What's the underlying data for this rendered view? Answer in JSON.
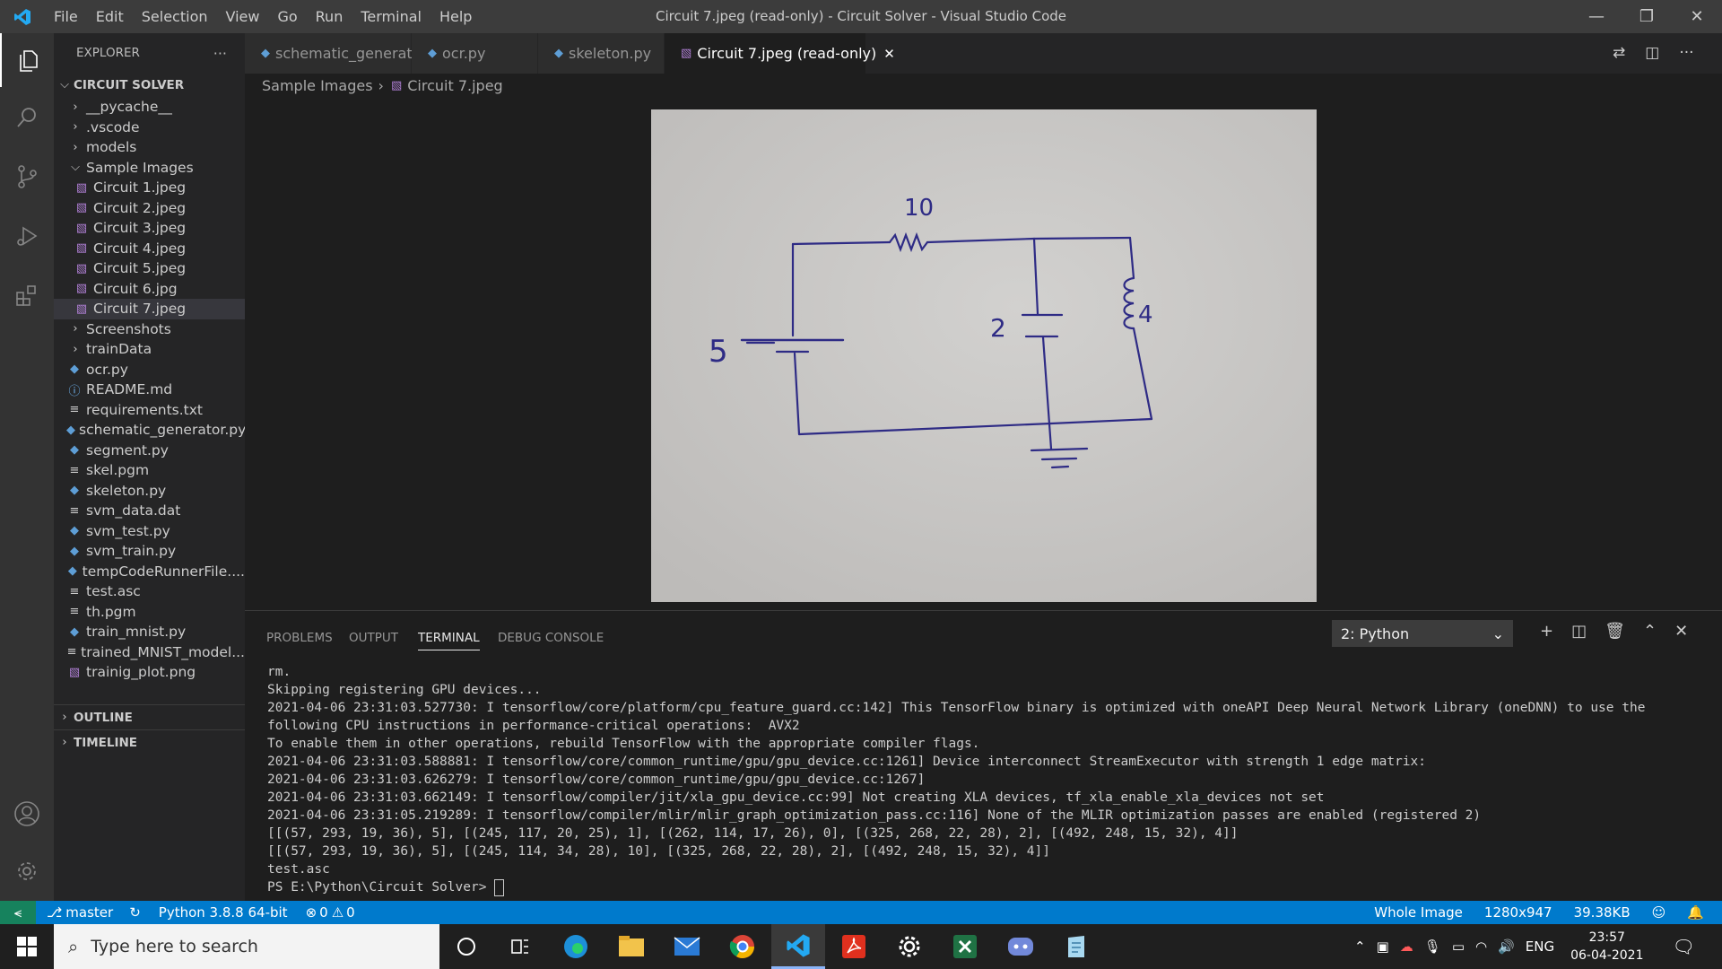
{
  "titlebar": {
    "menus": [
      "File",
      "Edit",
      "Selection",
      "View",
      "Go",
      "Run",
      "Terminal",
      "Help"
    ],
    "title": "Circuit 7.jpeg (read-only) - Circuit Solver - Visual Studio Code"
  },
  "sidebar": {
    "header": "EXPLORER",
    "project": "CIRCUIT SOLVER",
    "items": [
      {
        "label": "__pycache__",
        "kind": "folder"
      },
      {
        "label": ".vscode",
        "kind": "folder"
      },
      {
        "label": "models",
        "kind": "folder"
      },
      {
        "label": "Sample Images",
        "kind": "folder-open"
      },
      {
        "label": "Circuit 1.jpeg",
        "kind": "image"
      },
      {
        "label": "Circuit 2.jpeg",
        "kind": "image"
      },
      {
        "label": "Circuit 3.jpeg",
        "kind": "image"
      },
      {
        "label": "Circuit 4.jpeg",
        "kind": "image"
      },
      {
        "label": "Circuit 5.jpeg",
        "kind": "image"
      },
      {
        "label": "Circuit 6.jpg",
        "kind": "image"
      },
      {
        "label": "Circuit 7.jpeg",
        "kind": "image",
        "selected": true
      },
      {
        "label": "Screenshots",
        "kind": "folder"
      },
      {
        "label": "trainData",
        "kind": "folder"
      },
      {
        "label": "ocr.py",
        "kind": "python"
      },
      {
        "label": "README.md",
        "kind": "info"
      },
      {
        "label": "requirements.txt",
        "kind": "text"
      },
      {
        "label": "schematic_generator.py",
        "kind": "python"
      },
      {
        "label": "segment.py",
        "kind": "python"
      },
      {
        "label": "skel.pgm",
        "kind": "text"
      },
      {
        "label": "skeleton.py",
        "kind": "python"
      },
      {
        "label": "svm_data.dat",
        "kind": "text"
      },
      {
        "label": "svm_test.py",
        "kind": "python"
      },
      {
        "label": "svm_train.py",
        "kind": "python"
      },
      {
        "label": "tempCodeRunnerFile....",
        "kind": "python"
      },
      {
        "label": "test.asc",
        "kind": "text"
      },
      {
        "label": "th.pgm",
        "kind": "text"
      },
      {
        "label": "train_mnist.py",
        "kind": "python"
      },
      {
        "label": "trained_MNIST_model...",
        "kind": "text"
      },
      {
        "label": "trainig_plot.png",
        "kind": "image"
      }
    ],
    "outline": "OUTLINE",
    "timeline": "TIMELINE"
  },
  "tabs": [
    {
      "label": "schematic_generator.py",
      "kind": "python"
    },
    {
      "label": "ocr.py",
      "kind": "python"
    },
    {
      "label": "skeleton.py",
      "kind": "python"
    },
    {
      "label": "Circuit 7.jpeg (read-only)",
      "kind": "image",
      "active": true
    }
  ],
  "breadcrumb": {
    "folder": "Sample Images",
    "file": "Circuit 7.jpeg"
  },
  "circuit": {
    "resistor": "10",
    "source": "5",
    "capacitor": "2",
    "inductor": "4"
  },
  "panel": {
    "tabs": [
      "PROBLEMS",
      "OUTPUT",
      "TERMINAL",
      "DEBUG CONSOLE"
    ],
    "active_tab": "TERMINAL",
    "terminal_select": "2: Python",
    "lines": [
      "rm.",
      "Skipping registering GPU devices...",
      "2021-04-06 23:31:03.527730: I tensorflow/core/platform/cpu_feature_guard.cc:142] This TensorFlow binary is optimized with oneAPI Deep Neural Network Library (oneDNN) to use the",
      "following CPU instructions in performance-critical operations:  AVX2",
      "To enable them in other operations, rebuild TensorFlow with the appropriate compiler flags.",
      "2021-04-06 23:31:03.588881: I tensorflow/core/common_runtime/gpu/gpu_device.cc:1261] Device interconnect StreamExecutor with strength 1 edge matrix:",
      "2021-04-06 23:31:03.626279: I tensorflow/core/common_runtime/gpu/gpu_device.cc:1267]",
      "2021-04-06 23:31:03.662149: I tensorflow/compiler/jit/xla_gpu_device.cc:99] Not creating XLA devices, tf_xla_enable_xla_devices not set",
      "2021-04-06 23:31:05.219289: I tensorflow/compiler/mlir/mlir_graph_optimization_pass.cc:116] None of the MLIR optimization passes are enabled (registered 2)",
      "[[(57, 293, 19, 36), 5], [(245, 117, 20, 25), 1], [(262, 114, 17, 26), 0], [(325, 268, 22, 28), 2], [(492, 248, 15, 32), 4]]",
      "[[(57, 293, 19, 36), 5], [(245, 114, 34, 28), 10], [(325, 268, 22, 28), 2], [(492, 248, 15, 32), 4]]",
      "test.asc",
      "PS E:\\Python\\Circuit Solver> "
    ]
  },
  "statusbar": {
    "branch": "master",
    "interpreter": "Python 3.8.8 64-bit",
    "errors": "0",
    "warnings": "0",
    "image_scope": "Whole Image",
    "dimensions": "1280x947",
    "filesize": "39.38KB"
  },
  "taskbar": {
    "search_placeholder": "Type here to search",
    "language": "ENG",
    "time": "23:57",
    "date": "06-04-2021"
  },
  "colors": {
    "accent": "#007acc",
    "remote": "#16825d",
    "activity": "#333333",
    "sidebar": "#252526",
    "editor": "#1e1e1e"
  }
}
